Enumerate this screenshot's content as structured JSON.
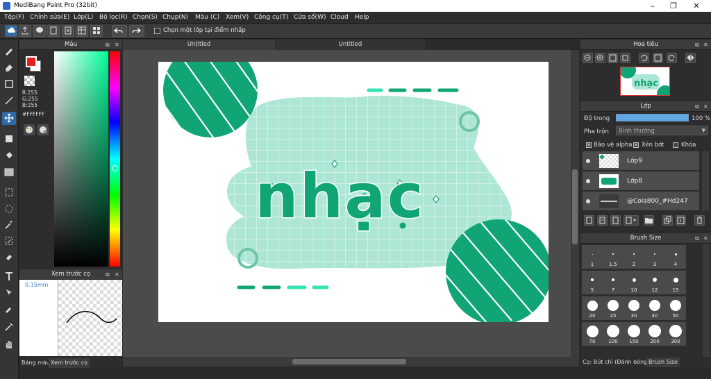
{
  "app": {
    "title": "MediBang Paint Pro (32bit)"
  },
  "menu": [
    "Tệp(F)",
    "Chỉnh sửa(E)",
    "Lớp(L)",
    "Bộ lọc(R)",
    "Chọn(S)",
    "Chụp(N)",
    "Màu (C)",
    "Xem(V)",
    "Công cụ(T)",
    "Cửa sổ(W)",
    "Cloud",
    "Help"
  ],
  "toolbar": {
    "checkbox_label": "Chọn một lớp tại điểm nhấp"
  },
  "color_panel": {
    "title": "Màu",
    "r": "R:255",
    "g": "G:255",
    "b": "B:255",
    "hex": "#FFFFFF"
  },
  "preview_panel": {
    "title": "Xem trước cọ",
    "size": "0.15mm"
  },
  "left_tabs": [
    "Bảng màu",
    "Xem trước cọ"
  ],
  "doc_tabs": [
    "Untitled",
    "Untitled"
  ],
  "canvas": {
    "text": "nhạc",
    "colors": {
      "green": "#11a576",
      "mint": "#aee6d5",
      "light": "#35e3b1",
      "white": "#ffffff"
    }
  },
  "navigator": {
    "title": "Hoa tiêu"
  },
  "layer_panel": {
    "title": "Lớp",
    "opacity_label": "Độ trong",
    "opacity_value": "100 %",
    "opacity_fraction": 1.0,
    "blend_label": "Pha trộn",
    "blend_value": "Bình thường",
    "protect_alpha": "Bảo vệ alpha",
    "clip": "Xén bớt",
    "lock": "Khóa",
    "layers": [
      {
        "name": "Lớp9"
      },
      {
        "name": "Lớp8"
      },
      {
        "name": "@Cola800_#Hd247"
      }
    ]
  },
  "brush_panel": {
    "title": "Brush Size",
    "sizes": [
      "1",
      "1.5",
      "2",
      "3",
      "4",
      "5",
      "7",
      "10",
      "12",
      "15",
      "20",
      "25",
      "30",
      "40",
      "50",
      "70",
      "100",
      "150",
      "200",
      "300"
    ]
  },
  "right_tabs": [
    "Cọ: Bút chì (Đánh bóng)",
    "Brush Size"
  ]
}
